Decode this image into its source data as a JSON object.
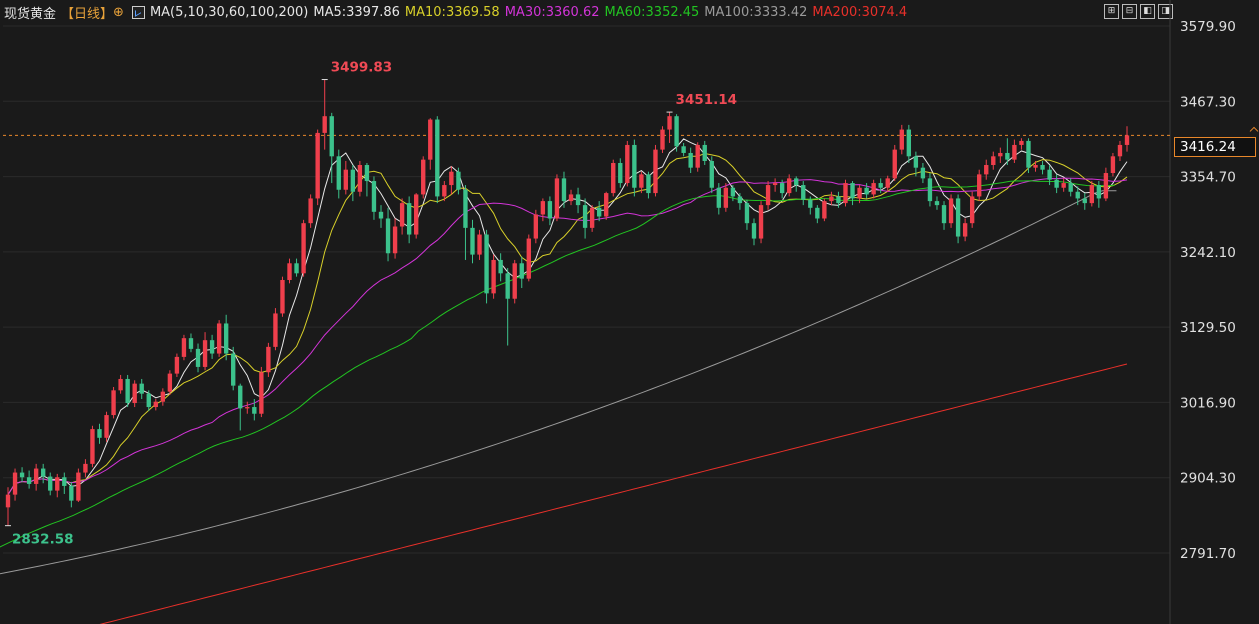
{
  "header": {
    "symbol": "现货黄金",
    "period": "【日线】",
    "add_icon": "⊕",
    "indicator_name": "MA(5,10,30,60,100,200)",
    "ma_labels": [
      {
        "text": "MA5:3397.86",
        "color": "#e8e8e8"
      },
      {
        "text": "MA10:3369.58",
        "color": "#d8d02a"
      },
      {
        "text": "MA30:3360.62",
        "color": "#d334d8"
      },
      {
        "text": "MA60:3352.45",
        "color": "#22c422"
      },
      {
        "text": "MA100:3333.42",
        "color": "#9a9a9a"
      },
      {
        "text": "MA200:3074.4",
        "color": "#e8302a"
      }
    ]
  },
  "toolbar_icons": [
    "expand-icon",
    "layout-icon",
    "prev-icon",
    "next-icon"
  ],
  "current_price": "3416.24",
  "chart_data": {
    "type": "candlestick",
    "ylim": [
      2770,
      3600
    ],
    "y_ticks": [
      "3579.90",
      "3467.30",
      "3354.70",
      "3242.10",
      "3129.50",
      "3016.90",
      "2904.30",
      "2791.70"
    ],
    "y_tick_values": [
      3579.9,
      3467.3,
      3354.7,
      3242.1,
      3129.5,
      3016.9,
      2904.3,
      2791.7
    ],
    "annotations": [
      {
        "text": "3499.83",
        "kind": "high",
        "value": 3499.83,
        "index": 45
      },
      {
        "text": "3451.14",
        "kind": "high",
        "value": 3451.14,
        "index": 94
      },
      {
        "text": "2832.58",
        "kind": "low",
        "value": 2832.58,
        "index": 0
      }
    ],
    "candles": [
      [
        2860,
        2879,
        2832.58,
        2890
      ],
      [
        2879,
        2912,
        2870,
        2918
      ],
      [
        2912,
        2905,
        2898,
        2920
      ],
      [
        2905,
        2895,
        2888,
        2915
      ],
      [
        2895,
        2918,
        2885,
        2925
      ],
      [
        2918,
        2906,
        2896,
        2925
      ],
      [
        2906,
        2885,
        2878,
        2912
      ],
      [
        2885,
        2905,
        2875,
        2910
      ],
      [
        2905,
        2892,
        2880,
        2912
      ],
      [
        2892,
        2870,
        2860,
        2898
      ],
      [
        2870,
        2912,
        2868,
        2918
      ],
      [
        2912,
        2925,
        2905,
        2932
      ],
      [
        2925,
        2977,
        2920,
        2982
      ],
      [
        2977,
        2964,
        2955,
        2985
      ],
      [
        2964,
        2998,
        2958,
        3003
      ],
      [
        2998,
        3035,
        2993,
        3040
      ],
      [
        3035,
        3052,
        3030,
        3058
      ],
      [
        3052,
        3016,
        3010,
        3058
      ],
      [
        3016,
        3045,
        3010,
        3050
      ],
      [
        3045,
        3030,
        3022,
        3052
      ],
      [
        3030,
        3010,
        3004,
        3035
      ],
      [
        3010,
        3018,
        3005,
        3022
      ],
      [
        3018,
        3033,
        3012,
        3038
      ],
      [
        3033,
        3060,
        3028,
        3065
      ],
      [
        3060,
        3085,
        3055,
        3090
      ],
      [
        3085,
        3113,
        3080,
        3118
      ],
      [
        3113,
        3097,
        3092,
        3120
      ],
      [
        3097,
        3070,
        3062,
        3105
      ],
      [
        3070,
        3110,
        3065,
        3122
      ],
      [
        3110,
        3090,
        3082,
        3118
      ],
      [
        3090,
        3135,
        3085,
        3140
      ],
      [
        3135,
        3090,
        3080,
        3148
      ],
      [
        3090,
        3042,
        3035,
        3100
      ],
      [
        3042,
        3008,
        2975,
        3045
      ],
      [
        3008,
        3010,
        3000,
        3018
      ],
      [
        3010,
        3000,
        2990,
        3022
      ],
      [
        3000,
        3062,
        2995,
        3070
      ],
      [
        3062,
        3100,
        3055,
        3106
      ],
      [
        3100,
        3150,
        3095,
        3158
      ],
      [
        3150,
        3200,
        3145,
        3205
      ],
      [
        3200,
        3225,
        3195,
        3232
      ],
      [
        3225,
        3210,
        3205,
        3232
      ],
      [
        3210,
        3285,
        3205,
        3290
      ],
      [
        3285,
        3322,
        3278,
        3328
      ],
      [
        3322,
        3420,
        3312,
        3425
      ],
      [
        3420,
        3445,
        3395,
        3499.83
      ],
      [
        3445,
        3385,
        3345,
        3450
      ],
      [
        3385,
        3335,
        3322,
        3395
      ],
      [
        3335,
        3365,
        3328,
        3378
      ],
      [
        3365,
        3332,
        3318,
        3372
      ],
      [
        3332,
        3372,
        3325,
        3378
      ],
      [
        3372,
        3348,
        3325,
        3375
      ],
      [
        3348,
        3302,
        3290,
        3355
      ],
      [
        3302,
        3292,
        3278,
        3312
      ],
      [
        3292,
        3240,
        3228,
        3308
      ],
      [
        3240,
        3280,
        3232,
        3292
      ],
      [
        3280,
        3315,
        3268,
        3322
      ],
      [
        3315,
        3268,
        3255,
        3325
      ],
      [
        3268,
        3328,
        3262,
        3330
      ],
      [
        3328,
        3380,
        3322,
        3385
      ],
      [
        3380,
        3440,
        3365,
        3442
      ],
      [
        3440,
        3325,
        3315,
        3445
      ],
      [
        3325,
        3342,
        3318,
        3348
      ],
      [
        3342,
        3362,
        3328,
        3370
      ],
      [
        3362,
        3335,
        3328,
        3368
      ],
      [
        3335,
        3278,
        3230,
        3342
      ],
      [
        3278,
        3238,
        3225,
        3290
      ],
      [
        3238,
        3268,
        3230,
        3275
      ],
      [
        3268,
        3180,
        3165,
        3275
      ],
      [
        3180,
        3230,
        3172,
        3238
      ],
      [
        3230,
        3210,
        3198,
        3240
      ],
      [
        3210,
        3172,
        3102,
        3218
      ],
      [
        3172,
        3225,
        3165,
        3230
      ],
      [
        3225,
        3202,
        3188,
        3235
      ],
      [
        3202,
        3262,
        3198,
        3268
      ],
      [
        3262,
        3298,
        3255,
        3305
      ],
      [
        3298,
        3318,
        3288,
        3322
      ],
      [
        3318,
        3292,
        3282,
        3325
      ],
      [
        3292,
        3352,
        3288,
        3358
      ],
      [
        3352,
        3318,
        3308,
        3362
      ],
      [
        3318,
        3328,
        3312,
        3335
      ],
      [
        3328,
        3312,
        3300,
        3338
      ],
      [
        3312,
        3278,
        3262,
        3322
      ],
      [
        3278,
        3308,
        3272,
        3312
      ],
      [
        3308,
        3295,
        3288,
        3318
      ],
      [
        3295,
        3330,
        3290,
        3332
      ],
      [
        3330,
        3375,
        3325,
        3380
      ],
      [
        3375,
        3345,
        3338,
        3382
      ],
      [
        3345,
        3402,
        3340,
        3408
      ],
      [
        3402,
        3338,
        3325,
        3410
      ],
      [
        3338,
        3358,
        3330,
        3362
      ],
      [
        3358,
        3330,
        3322,
        3362
      ],
      [
        3330,
        3395,
        3325,
        3402
      ],
      [
        3395,
        3425,
        3390,
        3430
      ],
      [
        3425,
        3445,
        3405,
        3451.14
      ],
      [
        3445,
        3400,
        3392,
        3448
      ],
      [
        3400,
        3390,
        3385,
        3405
      ],
      [
        3390,
        3368,
        3360,
        3398
      ],
      [
        3368,
        3402,
        3362,
        3406
      ],
      [
        3402,
        3378,
        3372,
        3408
      ],
      [
        3378,
        3338,
        3330,
        3385
      ],
      [
        3338,
        3308,
        3298,
        3345
      ],
      [
        3308,
        3338,
        3302,
        3345
      ],
      [
        3338,
        3325,
        3318,
        3342
      ],
      [
        3325,
        3315,
        3305,
        3330
      ],
      [
        3315,
        3285,
        3275,
        3320
      ],
      [
        3285,
        3262,
        3252,
        3292
      ],
      [
        3262,
        3312,
        3255,
        3318
      ],
      [
        3312,
        3342,
        3305,
        3348
      ],
      [
        3342,
        3345,
        3332,
        3352
      ],
      [
        3345,
        3330,
        3322,
        3350
      ],
      [
        3330,
        3352,
        3325,
        3358
      ],
      [
        3352,
        3342,
        3332,
        3355
      ],
      [
        3342,
        3320,
        3312,
        3348
      ],
      [
        3320,
        3308,
        3298,
        3325
      ],
      [
        3308,
        3292,
        3285,
        3312
      ],
      [
        3292,
        3318,
        3288,
        3322
      ],
      [
        3318,
        3325,
        3312,
        3332
      ],
      [
        3325,
        3315,
        3308,
        3332
      ],
      [
        3315,
        3345,
        3310,
        3350
      ],
      [
        3345,
        3322,
        3312,
        3348
      ],
      [
        3322,
        3338,
        3315,
        3342
      ],
      [
        3338,
        3328,
        3322,
        3345
      ],
      [
        3328,
        3345,
        3322,
        3350
      ],
      [
        3345,
        3338,
        3330,
        3352
      ],
      [
        3338,
        3352,
        3332,
        3356
      ],
      [
        3352,
        3395,
        3348,
        3402
      ],
      [
        3395,
        3425,
        3388,
        3432
      ],
      [
        3425,
        3385,
        3375,
        3432
      ],
      [
        3385,
        3368,
        3355,
        3392
      ],
      [
        3368,
        3352,
        3345,
        3375
      ],
      [
        3352,
        3318,
        3310,
        3360
      ],
      [
        3318,
        3312,
        3305,
        3325
      ],
      [
        3312,
        3285,
        3275,
        3318
      ],
      [
        3285,
        3322,
        3278,
        3328
      ],
      [
        3322,
        3265,
        3255,
        3328
      ],
      [
        3265,
        3285,
        3258,
        3292
      ],
      [
        3285,
        3325,
        3278,
        3332
      ],
      [
        3325,
        3358,
        3318,
        3365
      ],
      [
        3358,
        3372,
        3350,
        3380
      ],
      [
        3372,
        3385,
        3365,
        3392
      ],
      [
        3385,
        3390,
        3375,
        3398
      ],
      [
        3390,
        3380,
        3372,
        3412
      ],
      [
        3380,
        3402,
        3375,
        3410
      ],
      [
        3402,
        3408,
        3395,
        3412
      ],
      [
        3408,
        3368,
        3360,
        3412
      ],
      [
        3368,
        3372,
        3362,
        3378
      ],
      [
        3372,
        3365,
        3358,
        3378
      ],
      [
        3365,
        3350,
        3342,
        3372
      ],
      [
        3350,
        3338,
        3330,
        3358
      ],
      [
        3338,
        3345,
        3332,
        3352
      ],
      [
        3345,
        3332,
        3325,
        3352
      ],
      [
        3332,
        3322,
        3312,
        3340
      ],
      [
        3322,
        3315,
        3305,
        3330
      ],
      [
        3315,
        3342,
        3310,
        3348
      ],
      [
        3342,
        3322,
        3308,
        3348
      ],
      [
        3322,
        3360,
        3318,
        3368
      ],
      [
        3360,
        3385,
        3355,
        3390
      ],
      [
        3385,
        3402,
        3378,
        3408
      ],
      [
        3402,
        3416.24,
        3392,
        3430
      ]
    ]
  }
}
